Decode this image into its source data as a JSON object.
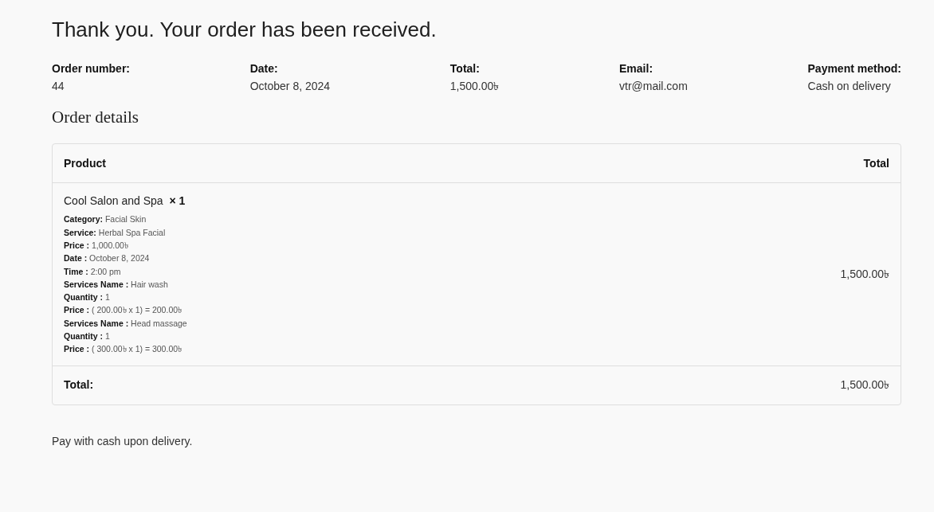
{
  "heading": "Thank you. Your order has been received.",
  "overview": [
    {
      "label": "Order number:",
      "value": "44"
    },
    {
      "label": "Date:",
      "value": "October 8, 2024"
    },
    {
      "label": "Total:",
      "value": "1,500.00৳"
    },
    {
      "label": "Email:",
      "value": "vtr@mail.com"
    },
    {
      "label": "Payment method:",
      "value": "Cash on delivery"
    }
  ],
  "order_details": {
    "title": "Order details",
    "table": {
      "columns": [
        "Product",
        "Total"
      ],
      "rows": [
        {
          "product": "Cool Salon and Spa",
          "quantity": "× 1",
          "meta": [
            "**Category:** Facial Skin",
            "**Service:** Herbal Spa Facial",
            "**Price :** 1,000.00৳",
            "**Date :** October 8, 2024",
            "**Time :** 2:00 pm",
            "**Services Name :** Hair wash",
            "**Quantity :** 1",
            "**Price :** ( 200.00৳ x 1) = 200.00৳",
            "**Services Name :** Head massage",
            "**Quantity :** 1",
            "**Price :** ( 300.00৳ x 1) = 300.00৳"
          ],
          "total": "1,500.00৳"
        }
      ],
      "footer": {
        "label": "Total:",
        "value": "1,500.00৳"
      }
    }
  },
  "payment_note": "Pay with cash upon delivery."
}
